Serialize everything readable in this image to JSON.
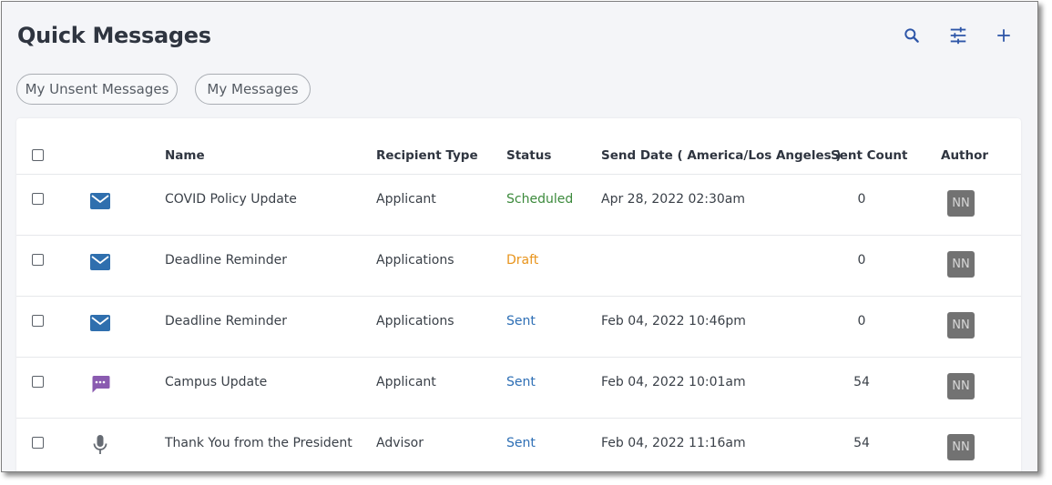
{
  "page": {
    "title": "Quick Messages"
  },
  "toolbar": {
    "search_icon": "search-icon",
    "filter_icon": "tune-icon",
    "add_icon": "plus-icon",
    "icon_color": "#2e56a8"
  },
  "filters": [
    {
      "label": "My Unsent Messages"
    },
    {
      "label": "My Messages"
    }
  ],
  "table": {
    "headers": {
      "name": "Name",
      "recipient_type": "Recipient Type",
      "status": "Status",
      "send_date": "Send Date ( America/Los Angeles )",
      "sent_count": "Sent Count",
      "author": "Author"
    },
    "rows": [
      {
        "icon": "email-icon",
        "name": "COVID Policy Update",
        "recipient_type": "Applicant",
        "status": "Scheduled",
        "status_color": "#3c8a3c",
        "send_date": "Apr 28, 2022 02:30am",
        "sent_count": "0",
        "author": "NN"
      },
      {
        "icon": "email-icon",
        "name": "Deadline Reminder",
        "recipient_type": "Applications",
        "status": "Draft",
        "status_color": "#e8941c",
        "send_date": "",
        "sent_count": "0",
        "author": "NN"
      },
      {
        "icon": "email-icon",
        "name": "Deadline Reminder",
        "recipient_type": "Applications",
        "status": "Sent",
        "status_color": "#2e6fb5",
        "send_date": "Feb 04, 2022 10:46pm",
        "sent_count": "0",
        "author": "NN"
      },
      {
        "icon": "sms-icon",
        "name": "Campus Update",
        "recipient_type": "Applicant",
        "status": "Sent",
        "status_color": "#2e6fb5",
        "send_date": "Feb 04, 2022 10:01am",
        "sent_count": "54",
        "author": "NN"
      },
      {
        "icon": "microphone-icon",
        "name": "Thank You from the President",
        "recipient_type": "Advisor",
        "status": "Sent",
        "status_color": "#2e6fb5",
        "send_date": "Feb 04, 2022 11:16am",
        "sent_count": "54",
        "author": "NN"
      }
    ]
  }
}
